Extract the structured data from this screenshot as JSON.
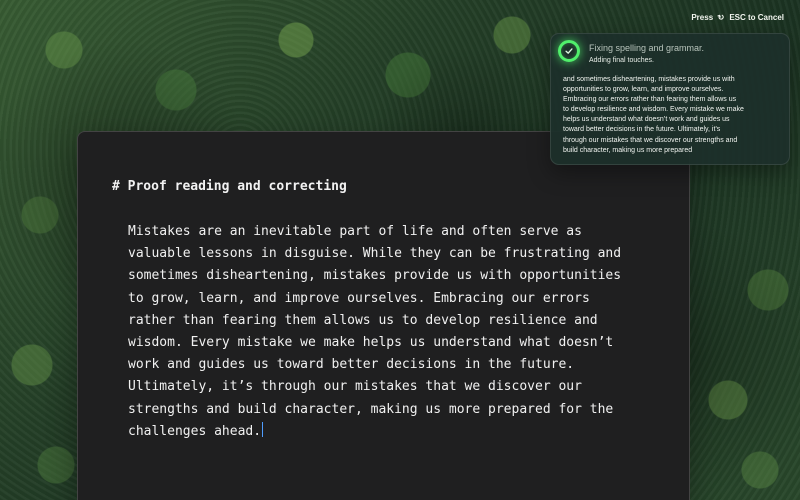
{
  "top_hint": {
    "prefix": "Press",
    "icon": "undo-icon",
    "suffix": "ESC to Cancel"
  },
  "toast": {
    "icon": "check-circle-icon",
    "accent": "#50ef6b",
    "title": "Fixing spelling and grammar.",
    "subtitle": "Adding final touches.",
    "preview_lines": [
      "and sometimes disheartening, mistakes provide us with",
      "opportunities to grow, learn, and improve ourselves.",
      "Embracing our errors rather than fearing them allows us",
      "to develop resilience and wisdom. Every mistake we make",
      "helps us understand what doesn’t work and guides us",
      "toward better decisions in the future. Ultimately, it’s",
      "through our mistakes that we discover our strengths and",
      "build character, making us more prepared"
    ]
  },
  "editor": {
    "heading": "# Proof reading and correcting",
    "lines": [
      "Mistakes are an inevitable part of life and often serve as",
      "valuable lessons in disguise. While they can be frustrating and",
      "sometimes disheartening, mistakes provide us with opportunities",
      "to grow, learn, and improve ourselves. Embracing our errors",
      "rather than fearing them allows us to develop resilience and",
      "wisdom. Every mistake we make helps us understand what doesn’t",
      "work and guides us toward better decisions in the future.",
      "Ultimately, it’s through our mistakes that we discover our",
      "strengths and build character, making us more prepared for the",
      "challenges ahead."
    ]
  }
}
